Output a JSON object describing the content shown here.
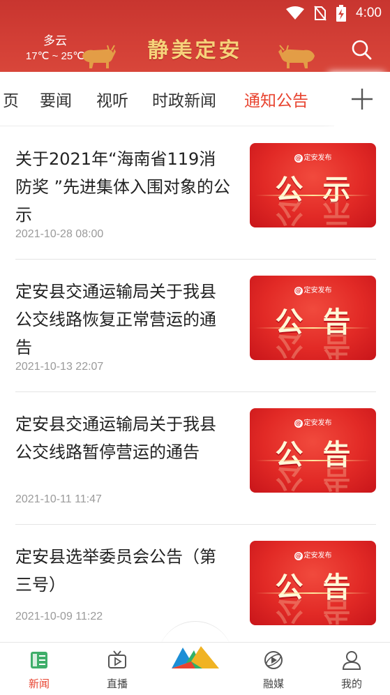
{
  "status_bar": {
    "time": "4:00"
  },
  "header": {
    "weather_condition": "多云",
    "weather_temp": "17℃ ~ 25℃",
    "app_title": "静美定安"
  },
  "tabs": [
    {
      "label": "页"
    },
    {
      "label": "要闻"
    },
    {
      "label": "视听"
    },
    {
      "label": "时政新闻"
    },
    {
      "label": "通知公告",
      "active": true
    }
  ],
  "articles": [
    {
      "title": "关于2021年“海南省119消防奖 ”先进集体入围对象的公示",
      "date": "2021-10-28 08:00",
      "thumb_text": "公示",
      "thumb_brand": "定安发布"
    },
    {
      "title": "定安县交通运输局关于我县公交线路恢复正常营运的通告",
      "date": "2021-10-13 22:07",
      "thumb_text": "公告",
      "thumb_brand": "定安发布"
    },
    {
      "title": "定安县交通运输局关于我县公交线路暂停营运的通告",
      "date": "2021-10-11 11:47",
      "thumb_text": "公告",
      "thumb_brand": "定安发布"
    },
    {
      "title": "定安县选举委员会公告（第三号）",
      "date": "2021-10-09 11:22",
      "thumb_text": "公告",
      "thumb_brand": "定安发布"
    }
  ],
  "bottom_nav": [
    {
      "label": "新闻",
      "icon": "news-icon",
      "active": true
    },
    {
      "label": "直播",
      "icon": "live-tv-icon"
    },
    {
      "label": "",
      "icon": "center-logo-icon"
    },
    {
      "label": "融媒",
      "icon": "media-icon"
    },
    {
      "label": "我的",
      "icon": "profile-icon"
    }
  ],
  "colors": {
    "brand_red": "#d33f36",
    "active_tab": "#e8432f",
    "title_gold": "#f6d27a"
  }
}
